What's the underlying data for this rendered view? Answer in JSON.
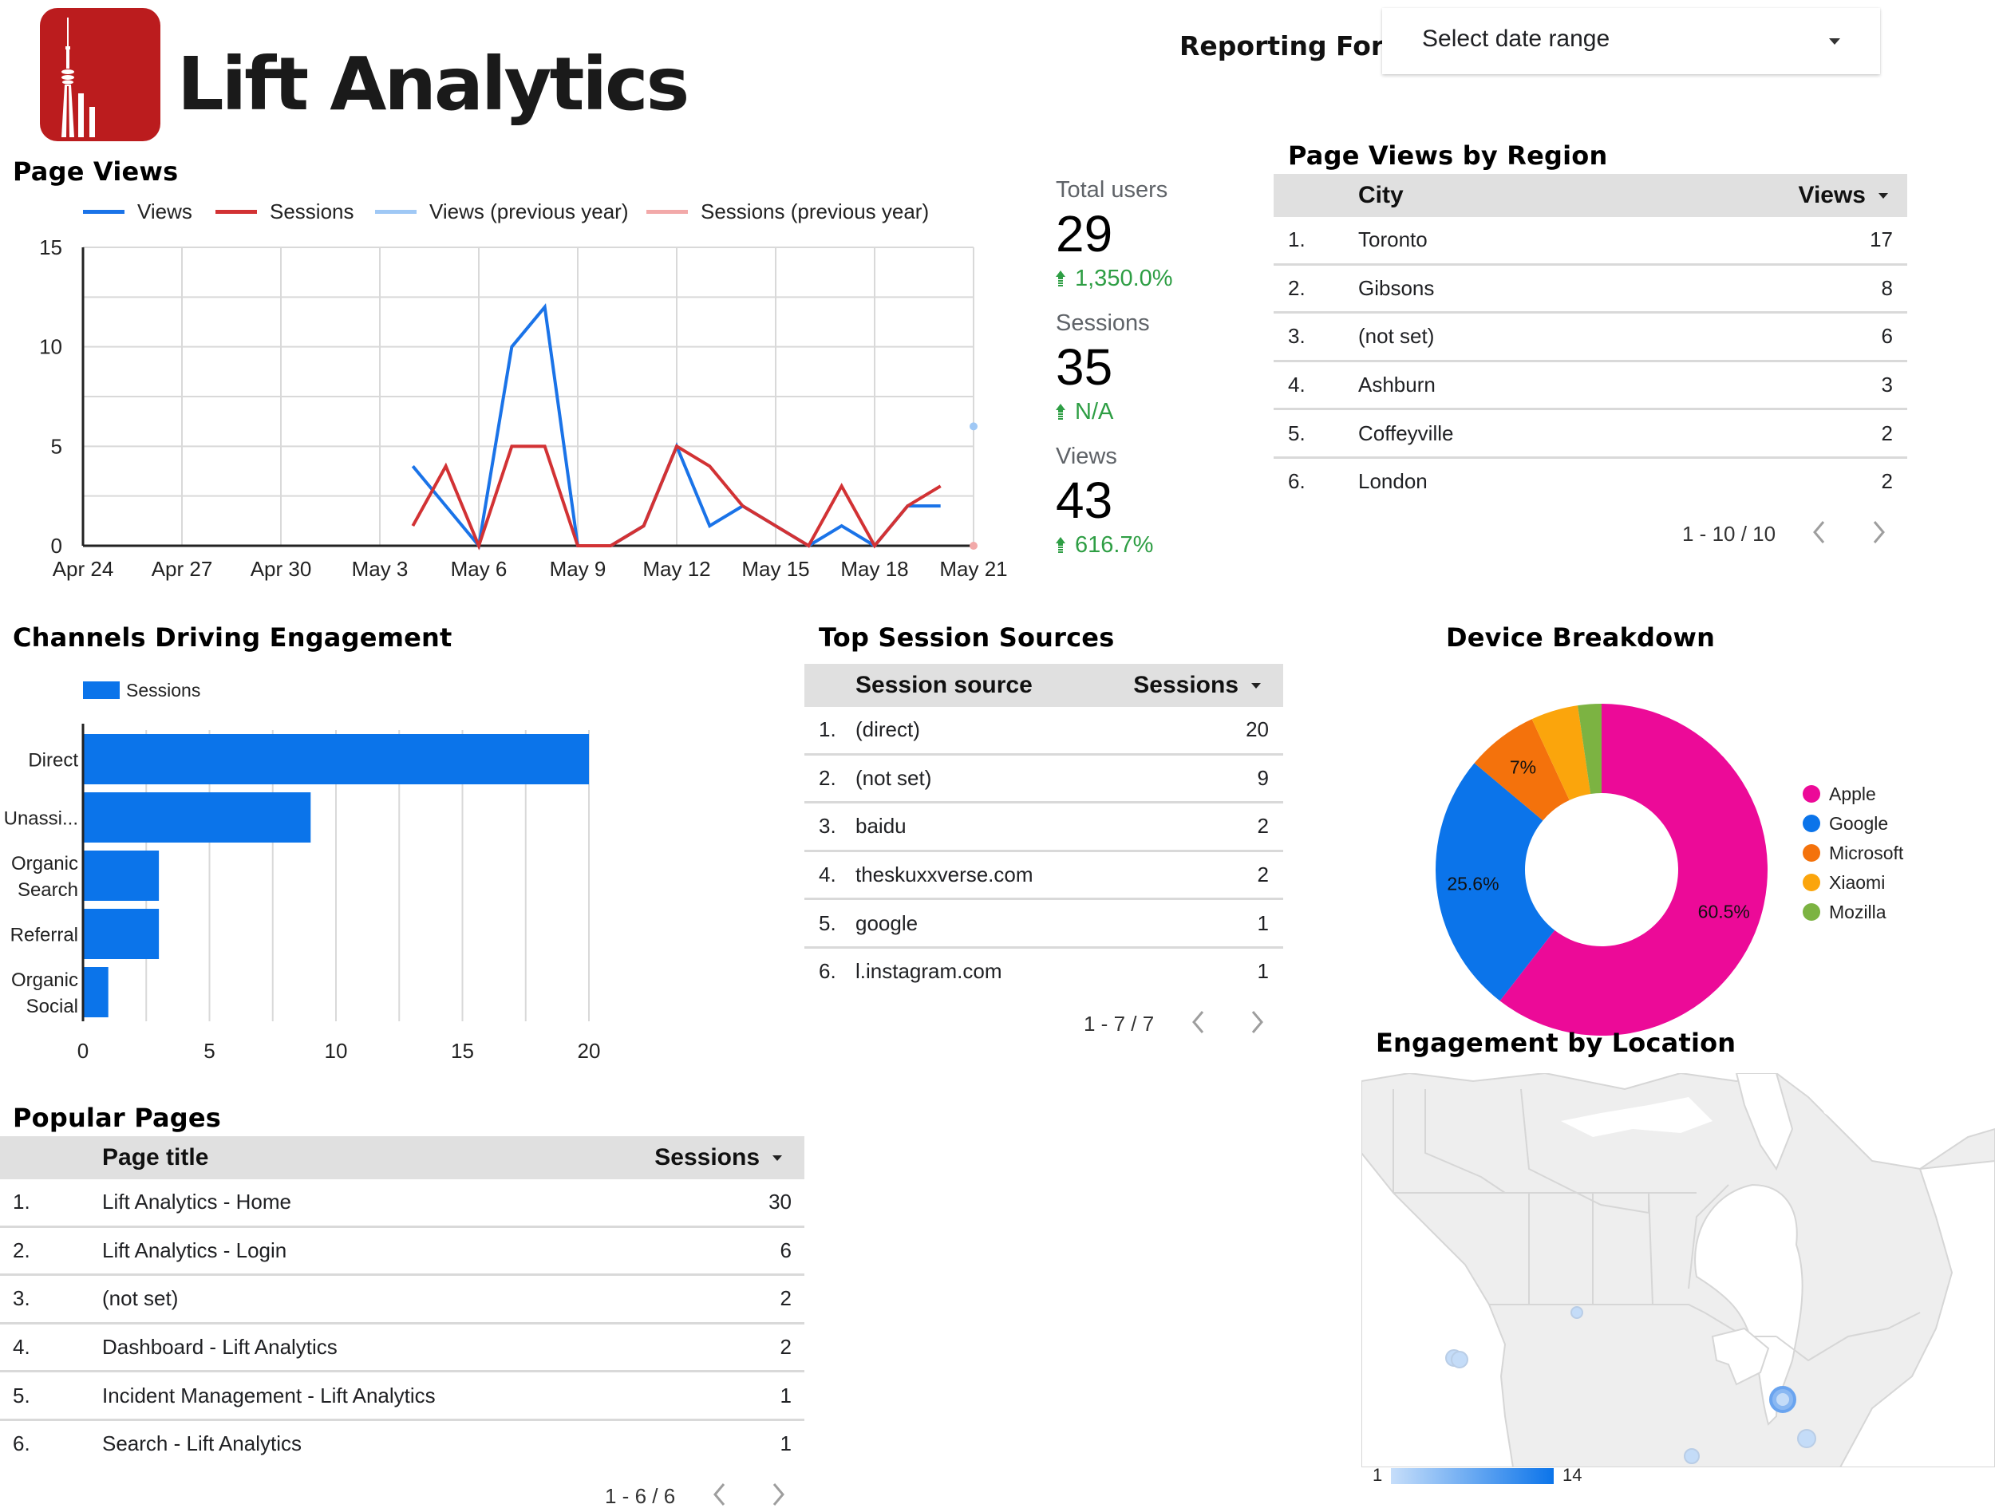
{
  "header": {
    "brand_name": "Lift Analytics",
    "reporting_label": "Reporting For:",
    "date_range": {
      "value": "Select date range"
    }
  },
  "page_views": {
    "title": "Page Views",
    "chart_data": {
      "type": "line",
      "title": "Page Views",
      "xlabel": "",
      "ylabel": "",
      "x": [
        "Apr 24",
        "Apr 25",
        "Apr 26",
        "Apr 27",
        "Apr 28",
        "Apr 29",
        "Apr 30",
        "May 1",
        "May 2",
        "May 3",
        "May 4",
        "May 5",
        "May 6",
        "May 7",
        "May 8",
        "May 9",
        "May 10",
        "May 11",
        "May 12",
        "May 13",
        "May 14",
        "May 15",
        "May 16",
        "May 17",
        "May 18",
        "May 19",
        "May 20",
        "May 21"
      ],
      "x_tick_labels": [
        "Apr 24",
        "Apr 27",
        "Apr 30",
        "May 3",
        "May 6",
        "May 9",
        "May 12",
        "May 15",
        "May 18",
        "May 21"
      ],
      "y_tick_labels": [
        "0",
        "5",
        "10",
        "15"
      ],
      "ylim": [
        0,
        15
      ],
      "grid": true,
      "legend_position": "top",
      "series": [
        {
          "name": "Views",
          "color": "#1a73e8",
          "values": [
            null,
            null,
            null,
            null,
            null,
            null,
            null,
            null,
            null,
            null,
            4,
            2,
            0,
            10,
            12,
            0,
            0,
            1,
            5,
            1,
            2,
            1,
            0,
            1,
            0,
            2,
            2,
            null
          ]
        },
        {
          "name": "Sessions",
          "color": "#d23234",
          "values": [
            null,
            null,
            null,
            null,
            null,
            null,
            null,
            null,
            null,
            null,
            1,
            4,
            0,
            5,
            5,
            0,
            0,
            1,
            5,
            4,
            2,
            1,
            0,
            3,
            0,
            2,
            3,
            null
          ]
        },
        {
          "name": "Views (previous year)",
          "color": "#9fc8f5",
          "values": [
            null,
            null,
            null,
            null,
            null,
            null,
            null,
            null,
            null,
            null,
            null,
            null,
            null,
            null,
            null,
            null,
            null,
            null,
            null,
            null,
            null,
            null,
            null,
            null,
            null,
            null,
            null,
            6
          ]
        },
        {
          "name": "Sessions (previous year)",
          "color": "#f2a9a9",
          "values": [
            null,
            null,
            null,
            null,
            null,
            null,
            null,
            null,
            null,
            null,
            null,
            null,
            null,
            null,
            null,
            null,
            null,
            null,
            null,
            null,
            null,
            null,
            null,
            null,
            null,
            null,
            null,
            0
          ]
        }
      ]
    }
  },
  "scorecards": [
    {
      "label": "Total users",
      "value": "29",
      "delta": "1,350.0%"
    },
    {
      "label": "Sessions",
      "value": "35",
      "delta": "N/A"
    },
    {
      "label": "Views",
      "value": "43",
      "delta": "616.7%"
    }
  ],
  "region_table": {
    "title": "Page Views by Region",
    "columns": [
      "City",
      "Views"
    ],
    "rows": [
      {
        "rank": "1.",
        "name": "Toronto",
        "value": "17"
      },
      {
        "rank": "2.",
        "name": "Gibsons",
        "value": "8"
      },
      {
        "rank": "3.",
        "name": "(not set)",
        "value": "6"
      },
      {
        "rank": "4.",
        "name": "Ashburn",
        "value": "3"
      },
      {
        "rank": "5.",
        "name": "Coffeyville",
        "value": "2"
      },
      {
        "rank": "6.",
        "name": "London",
        "value": "2"
      }
    ],
    "pagination": "1 - 10 / 10"
  },
  "channels": {
    "title": "Channels Driving Engagement",
    "chart_data": {
      "type": "bar",
      "orientation": "horizontal",
      "title": "Channels Driving Engagement",
      "categories": [
        "Direct",
        "Unassi...",
        "Organic Search",
        "Referral",
        "Organic Social"
      ],
      "series": [
        {
          "name": "Sessions",
          "color": "#0b74ea",
          "values": [
            20,
            9,
            3,
            3,
            1
          ]
        }
      ],
      "x_tick_labels": [
        "0",
        "5",
        "10",
        "15",
        "20"
      ],
      "xlim": [
        0,
        20
      ],
      "grid": true,
      "legend_position": "top-left"
    }
  },
  "sources_table": {
    "title": "Top Session Sources",
    "columns": [
      "Session source",
      "Sessions"
    ],
    "rows": [
      {
        "rank": "1.",
        "name": "(direct)",
        "value": "20"
      },
      {
        "rank": "2.",
        "name": "(not set)",
        "value": "9"
      },
      {
        "rank": "3.",
        "name": "baidu",
        "value": "2"
      },
      {
        "rank": "4.",
        "name": "theskuxxverse.com",
        "value": "2"
      },
      {
        "rank": "5.",
        "name": "google",
        "value": "1"
      },
      {
        "rank": "6.",
        "name": "l.instagram.com",
        "value": "1"
      }
    ],
    "pagination": "1 - 7 / 7"
  },
  "device": {
    "title": "Device Breakdown",
    "chart_data": {
      "type": "pie",
      "donut": true,
      "title": "Device Breakdown",
      "categories": [
        "Apple",
        "Google",
        "Microsoft",
        "Xiaomi",
        "Mozilla"
      ],
      "values": [
        60.5,
        25.6,
        7.0,
        4.6,
        2.3
      ],
      "data_labels": [
        "60.5%",
        "25.6%",
        "7%",
        "",
        ""
      ],
      "colors": [
        "#ec0a98",
        "#0b74ea",
        "#f4720c",
        "#fba50c",
        "#7cb342"
      ],
      "legend_position": "right"
    }
  },
  "location": {
    "title": "Engagement by Location",
    "scale_min": "1",
    "scale_max": "14",
    "points": [
      {
        "place": "Toronto",
        "weight": 14
      },
      {
        "place": "Gibsons",
        "weight": 5
      },
      {
        "place": "Vancouver area",
        "weight": 3
      },
      {
        "place": "Alberta",
        "weight": 1
      },
      {
        "place": "Ashburn",
        "weight": 3
      },
      {
        "place": "Coffeyville",
        "weight": 2
      }
    ]
  },
  "pages_table": {
    "title": "Popular Pages",
    "columns": [
      "Page title",
      "Sessions"
    ],
    "rows": [
      {
        "rank": "1.",
        "name": "Lift Analytics - Home",
        "value": "30"
      },
      {
        "rank": "2.",
        "name": "Lift Analytics - Login",
        "value": "6"
      },
      {
        "rank": "3.",
        "name": "(not set)",
        "value": "2"
      },
      {
        "rank": "4.",
        "name": "Dashboard - Lift Analytics",
        "value": "2"
      },
      {
        "rank": "5.",
        "name": "Incident Management - Lift Analytics",
        "value": "1"
      },
      {
        "rank": "6.",
        "name": "Search - Lift Analytics",
        "value": "1"
      }
    ],
    "pagination": "1 - 6 / 6"
  }
}
